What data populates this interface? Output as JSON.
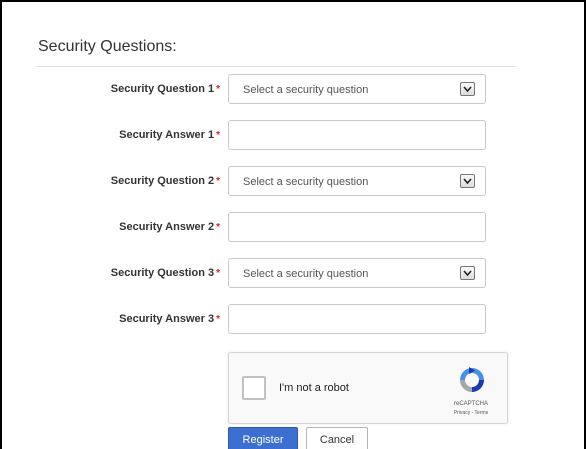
{
  "section": {
    "title": "Security Questions:"
  },
  "required_mark": "*",
  "rows": [
    {
      "label": "Security Question 1",
      "type": "select",
      "value": "Select a security question"
    },
    {
      "label": "Security Answer 1",
      "type": "input",
      "value": ""
    },
    {
      "label": "Security Question 2",
      "type": "select",
      "value": "Select a security question"
    },
    {
      "label": "Security Answer 2",
      "type": "input",
      "value": ""
    },
    {
      "label": "Security Question 3",
      "type": "select",
      "value": "Select a security question"
    },
    {
      "label": "Security Answer 3",
      "type": "input",
      "value": ""
    }
  ],
  "captcha": {
    "label": "I'm not a robot",
    "brand": "reCAPTCHA",
    "terms": "Privacy - Terms",
    "checked": false
  },
  "buttons": {
    "register": "Register",
    "cancel": "Cancel"
  },
  "colors": {
    "required": "#d9231d",
    "primary": "#3d6fd1"
  }
}
